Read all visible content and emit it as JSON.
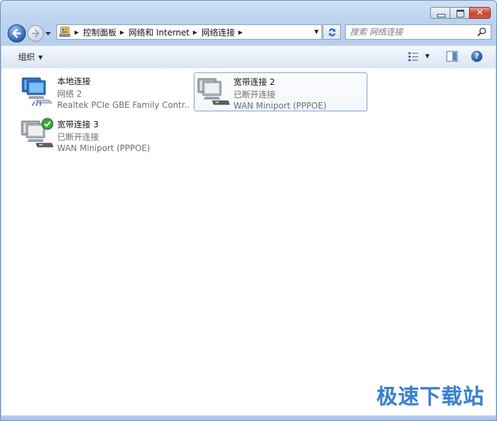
{
  "window": {
    "caption": {
      "minimize": "",
      "maximize": "",
      "close": "✕"
    }
  },
  "address": {
    "crumbs": [
      "控制面板",
      "网络和 Internet",
      "网络连接"
    ]
  },
  "search": {
    "placeholder": "搜索 网络连接"
  },
  "toolbar": {
    "organize_label": "组织"
  },
  "connections": [
    {
      "name": "本地连接",
      "status": "网络  2",
      "device": "Realtek PCIe GBE Family Contr...",
      "connected": true
    },
    {
      "name": "宽带连接 2",
      "status": "已断开连接",
      "device": "WAN Miniport (PPPOE)",
      "connected": false,
      "selected": true
    },
    {
      "name": "宽带连接 3",
      "status": "已断开连接",
      "device": "WAN Miniport (PPPOE)",
      "connected": true
    }
  ],
  "watermark": "极速下载站",
  "colors": {
    "accent": "#2d62b3",
    "selection_border": "#7da2ce",
    "watermark": "#3b7fd0"
  }
}
